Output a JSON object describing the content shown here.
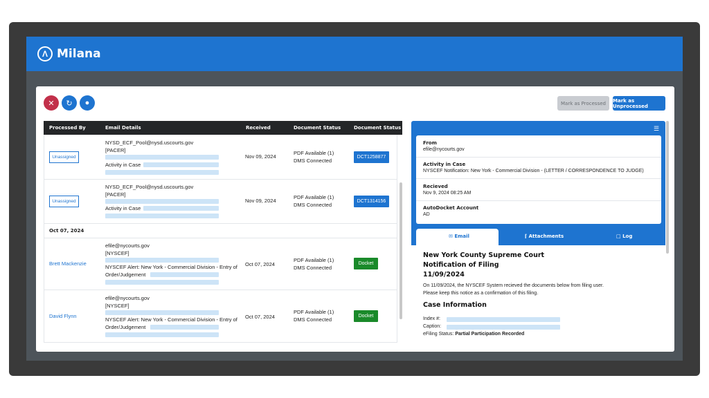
{
  "brand": {
    "name": "Milana",
    "logo_icon": "milana-logo-icon"
  },
  "toolbar": {
    "icons": [
      "close-circle-icon",
      "refresh-icon",
      "user-icon"
    ],
    "mark_processed": "Mark as Processed",
    "mark_unprocessed": "Mark as Unprocessed",
    "colors": {
      "close": "#c2304a",
      "accent": "#1e74d0",
      "docket": "#1a8a2a"
    }
  },
  "table": {
    "headers": [
      "Processed By",
      "Email Details",
      "Received",
      "Document Status",
      "Document Status"
    ],
    "group_label": "Oct 07, 2024",
    "rows": [
      {
        "processed_by": "Unassigned",
        "email_from": "NYSD_ECF_Pool@nysd.uscourts.gov",
        "email_tag": "[PACER]",
        "email_subject": "Activity in Case",
        "received": "Nov 09, 2024",
        "status_line1": "PDF Available (1)",
        "status_line2": "DMS Connected",
        "doc_tag": "DCT1258877"
      },
      {
        "processed_by": "Unassigned",
        "email_from": "NYSD_ECF_Pool@nysd.uscourts.gov",
        "email_tag": "[PACER]",
        "email_subject": "Activity in Case",
        "received": "Nov 09, 2024",
        "status_line1": "PDF Available (1)",
        "status_line2": "DMS Connected",
        "doc_tag": "DCT1314156"
      },
      {
        "processed_by": "Brett Mackenzie",
        "email_from": "efile@nycourts.gov",
        "email_tag": "[NYSCEF]",
        "email_subject_line1": "NYSCEF Alert: New York - Commercial Division - Entry of",
        "email_subject_line2": "Order/Judgement",
        "received": "Oct 07, 2024",
        "status_line1": "PDF Available (1)",
        "status_line2": "DMS Connected",
        "doc_tag": "Docket"
      },
      {
        "processed_by": "David Flynn",
        "email_from": "efile@nycourts.gov",
        "email_tag": "[NYSCEF]",
        "email_subject_line1": "NYSCEF Alert: New York - Commercial Division - Entry of",
        "email_subject_line2": "Order/Judgement",
        "received": "Oct 07, 2024",
        "status_line1": "PDF Available (1)",
        "status_line2": "DMS Connected",
        "doc_tag": "Docket"
      }
    ]
  },
  "detail": {
    "menu_icon": "hamburger-menu-icon",
    "from_label": "From",
    "from_value": "efile@nycourts.gov",
    "activity_label": "Activity in Case",
    "activity_value": "NYSCEF Notification: New York - Commercial Division - (LETTER / CORRESPONDENCE TO JUDGE)",
    "received_label": "Recieved",
    "received_value": "Nov 9, 2024 08:25 AM",
    "account_label": "AutoDocket Account",
    "account_value": "AD",
    "tabs": [
      {
        "label": "Email",
        "icon": "mail-icon"
      },
      {
        "label": "Attachments",
        "icon": "paperclip-icon"
      },
      {
        "label": "Log",
        "icon": "document-icon"
      }
    ],
    "email": {
      "court": "New York County Supreme Court",
      "notice": "Notification of Filing",
      "date": "11/09/2024",
      "para1": "On 11/09/2024, the NYSCEF System recieved the documents below from filing user.",
      "para2": "Please keep this notice as a confirmation of this filing.",
      "case_heading": "Case Information",
      "index_label": "Index #:",
      "caption_label": "Caption:",
      "efiling_label": "eFiling Status:",
      "efiling_value": "Partial Participation Recorded"
    }
  }
}
